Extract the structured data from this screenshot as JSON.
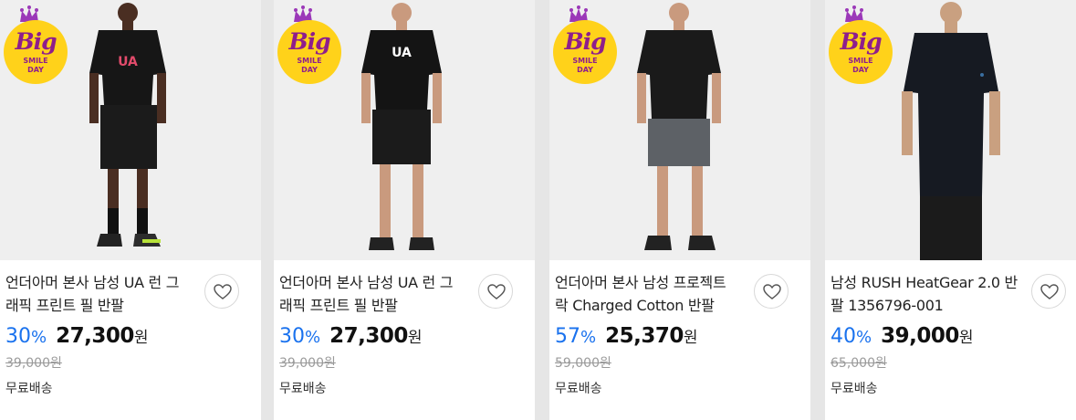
{
  "products": [
    {
      "title_line1": "언더아머 본사 남성 UA 런 그",
      "title_line2": "래픽 프린트 필 반팔",
      "discount": "30",
      "percent": "%",
      "price": "27,300",
      "currency": "원",
      "original_price": "39,000원",
      "shipping": "무료배송",
      "badge_big": "Big",
      "badge_line1": "SMILE",
      "badge_line2": "DAY",
      "shorts_color": "#1b1b1b",
      "shirt_logo": "UA"
    },
    {
      "title_line1": "언더아머 본사 남성 UA 런 그",
      "title_line2": "래픽 프린트 필 반팔",
      "discount": "30",
      "percent": "%",
      "price": "27,300",
      "currency": "원",
      "original_price": "39,000원",
      "shipping": "무료배송",
      "badge_big": "Big",
      "badge_line1": "SMILE",
      "badge_line2": "DAY",
      "shorts_color": "#1b1b1b",
      "shirt_logo": "UA"
    },
    {
      "title_line1": "언더아머 본사 남성 프로젝트",
      "title_line2": "락 Charged Cotton 반팔",
      "discount": "57",
      "percent": "%",
      "price": "25,370",
      "currency": "원",
      "original_price": "59,000원",
      "shipping": "무료배송",
      "badge_big": "Big",
      "badge_line1": "SMILE",
      "badge_line2": "DAY",
      "shorts_color": "#5d6166",
      "shirt_logo": ""
    },
    {
      "title_line1": "남성 RUSH HeatGear 2.0 반",
      "title_line2": "팔 1356796-001",
      "discount": "40",
      "percent": "%",
      "price": "39,000",
      "currency": "원",
      "original_price": "65,000원",
      "shipping": "무료배송",
      "badge_big": "Big",
      "badge_line1": "SMILE",
      "badge_line2": "DAY",
      "shorts_color": "#1b1b1b",
      "shirt_logo": ""
    }
  ],
  "colors": {
    "discount": "#1a72ee",
    "badge_yellow": "#ffd21a",
    "badge_purple": "#8e1e8c"
  }
}
